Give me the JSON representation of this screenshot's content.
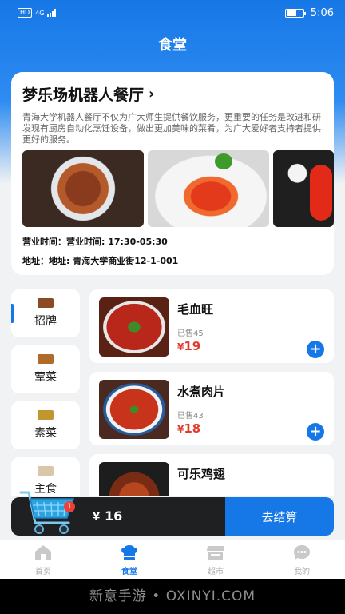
{
  "status_bar": {
    "left_badge": "HD",
    "network": "4G",
    "time": "5:06"
  },
  "header": {
    "title": "食堂"
  },
  "shop": {
    "name": "梦乐场机器人餐厅",
    "chevron": "›",
    "description": "青海大学机器人餐厅不仅为广大师生提供餐饮服务，更重要的任务是改进和研发现有厨房自动化烹饪设备，做出更加美味的菜肴，为广大爱好者支持者提供更好的服务。",
    "hours": "营业时间：营业时间: 17:30-05:30",
    "address": "地址：地址: 青海大学商业街12-1-001"
  },
  "categories": [
    {
      "label": "招牌",
      "thumb_color": "#8a4a22"
    },
    {
      "label": "荤菜",
      "thumb_color": "#b06a2a"
    },
    {
      "label": "素菜",
      "thumb_color": "#c2962e"
    },
    {
      "label": "主食",
      "thumb_color": "#d9c7a8"
    }
  ],
  "dishes": [
    {
      "name": "毛血旺",
      "sold": "已售45",
      "currency": "¥",
      "price": "19"
    },
    {
      "name": "水煮肉片",
      "sold": "已售43",
      "currency": "¥",
      "price": "18"
    },
    {
      "name": "可乐鸡翅",
      "sold": "",
      "currency": "¥",
      "price": ""
    }
  ],
  "cart": {
    "badge_count": "1",
    "currency": "¥",
    "total": "16",
    "checkout_label": "去结算"
  },
  "tabbar": {
    "items": [
      {
        "label": "首页",
        "icon": "home-icon",
        "active": false
      },
      {
        "label": "食堂",
        "icon": "chef-hat-icon",
        "active": true
      },
      {
        "label": "超市",
        "icon": "store-icon",
        "active": false
      },
      {
        "label": "我的",
        "icon": "chat-bubble-icon",
        "active": false
      }
    ]
  },
  "watermark": {
    "text": "新意手游 • OXINYI.COM"
  },
  "colors": {
    "accent": "#1677e6",
    "price": "#e23b2e",
    "cart_dark": "#1f2022"
  }
}
